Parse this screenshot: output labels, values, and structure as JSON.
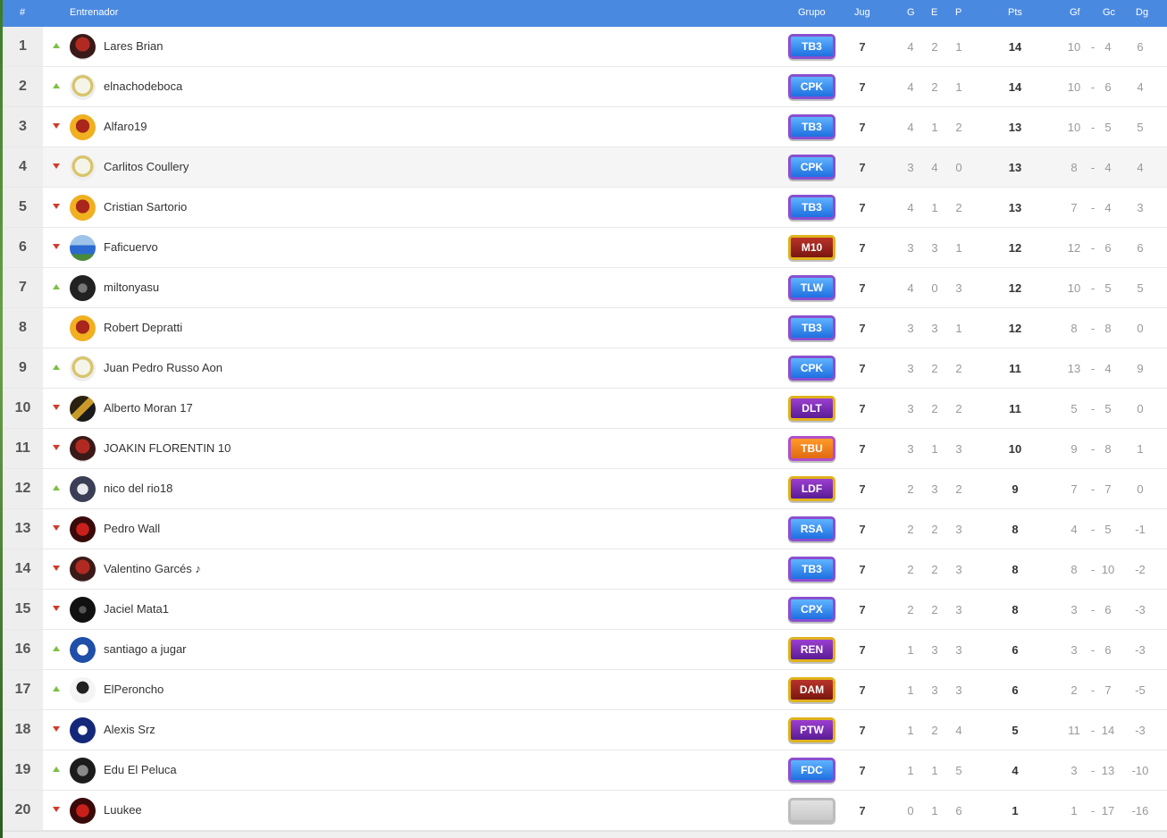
{
  "header": {
    "rank": "#",
    "coach": "Entrenador",
    "group": "Grupo",
    "played": "Jug",
    "won": "G",
    "drawn": "E",
    "lost": "P",
    "points": "Pts",
    "goals_for": "Gf",
    "goals_against": "Gc",
    "goal_diff": "Dg"
  },
  "colors": {
    "header_bg": "#4a89e0",
    "arrow_up": "#7bc043",
    "arrow_down": "#d13b2b"
  },
  "rows": [
    {
      "rank": "1",
      "trend": "up",
      "name": "Lares Brian",
      "group": "TB3",
      "badge": "blue",
      "avatar": "dark-red",
      "jug": "7",
      "g": "4",
      "e": "2",
      "p": "1",
      "pts": "14",
      "gf": "10",
      "gc": "4",
      "dg": "6"
    },
    {
      "rank": "2",
      "trend": "up",
      "name": "elnachodeboca",
      "group": "CPK",
      "badge": "blue",
      "avatar": "white-shirt",
      "jug": "7",
      "g": "4",
      "e": "2",
      "p": "1",
      "pts": "14",
      "gf": "10",
      "gc": "6",
      "dg": "4"
    },
    {
      "rank": "3",
      "trend": "down",
      "name": "Alfaro19",
      "group": "TB3",
      "badge": "blue",
      "avatar": "yellow-red",
      "jug": "7",
      "g": "4",
      "e": "1",
      "p": "2",
      "pts": "13",
      "gf": "10",
      "gc": "5",
      "dg": "5"
    },
    {
      "rank": "4",
      "trend": "down",
      "name": "Carlitos Coullery",
      "group": "CPK",
      "badge": "blue",
      "avatar": "white-shirt",
      "jug": "7",
      "g": "3",
      "e": "4",
      "p": "0",
      "pts": "13",
      "gf": "8",
      "gc": "4",
      "dg": "4"
    },
    {
      "rank": "5",
      "trend": "down",
      "name": "Cristian Sartorio",
      "group": "TB3",
      "badge": "blue",
      "avatar": "yellow-red",
      "jug": "7",
      "g": "4",
      "e": "1",
      "p": "2",
      "pts": "13",
      "gf": "7",
      "gc": "4",
      "dg": "3"
    },
    {
      "rank": "6",
      "trend": "down",
      "name": "Faficuervo",
      "group": "M10",
      "badge": "red",
      "avatar": "field",
      "jug": "7",
      "g": "3",
      "e": "3",
      "p": "1",
      "pts": "12",
      "gf": "12",
      "gc": "6",
      "dg": "6"
    },
    {
      "rank": "7",
      "trend": "up",
      "name": "miltonyasu",
      "group": "TLW",
      "badge": "blue",
      "avatar": "dark",
      "jug": "7",
      "g": "4",
      "e": "0",
      "p": "3",
      "pts": "12",
      "gf": "10",
      "gc": "5",
      "dg": "5"
    },
    {
      "rank": "8",
      "trend": "none",
      "name": "Robert Depratti",
      "group": "TB3",
      "badge": "blue",
      "avatar": "yellow-red",
      "jug": "7",
      "g": "3",
      "e": "3",
      "p": "1",
      "pts": "12",
      "gf": "8",
      "gc": "8",
      "dg": "0"
    },
    {
      "rank": "9",
      "trend": "up",
      "name": "Juan Pedro Russo Aon",
      "group": "CPK",
      "badge": "blue",
      "avatar": "white-shirt",
      "jug": "7",
      "g": "3",
      "e": "2",
      "p": "2",
      "pts": "11",
      "gf": "13",
      "gc": "4",
      "dg": "9"
    },
    {
      "rank": "10",
      "trend": "down",
      "name": "Alberto Moran 17",
      "group": "DLT",
      "badge": "purple",
      "avatar": "car",
      "jug": "7",
      "g": "3",
      "e": "2",
      "p": "2",
      "pts": "11",
      "gf": "5",
      "gc": "5",
      "dg": "0"
    },
    {
      "rank": "11",
      "trend": "down",
      "name": "JOAKIN FLORENTIN 10",
      "group": "TBU",
      "badge": "orange",
      "avatar": "dark-red",
      "jug": "7",
      "g": "3",
      "e": "1",
      "p": "3",
      "pts": "10",
      "gf": "9",
      "gc": "8",
      "dg": "1"
    },
    {
      "rank": "12",
      "trend": "up",
      "name": "nico del rio18",
      "group": "LDF",
      "badge": "purple",
      "avatar": "grey-crest",
      "jug": "7",
      "g": "2",
      "e": "3",
      "p": "2",
      "pts": "9",
      "gf": "7",
      "gc": "7",
      "dg": "0"
    },
    {
      "rank": "13",
      "trend": "down",
      "name": "Pedro Wall",
      "group": "RSA",
      "badge": "blue",
      "avatar": "red-skull",
      "jug": "7",
      "g": "2",
      "e": "2",
      "p": "3",
      "pts": "8",
      "gf": "4",
      "gc": "5",
      "dg": "-1"
    },
    {
      "rank": "14",
      "trend": "down",
      "name": "Valentino Garcés ♪",
      "group": "TB3",
      "badge": "blue",
      "avatar": "dark-red",
      "jug": "7",
      "g": "2",
      "e": "2",
      "p": "3",
      "pts": "8",
      "gf": "8",
      "gc": "10",
      "dg": "-2"
    },
    {
      "rank": "15",
      "trend": "down",
      "name": "Jaciel Mata1",
      "group": "CPX",
      "badge": "blue",
      "avatar": "black-shirt",
      "jug": "7",
      "g": "2",
      "e": "2",
      "p": "3",
      "pts": "8",
      "gf": "3",
      "gc": "6",
      "dg": "-3"
    },
    {
      "rank": "16",
      "trend": "up",
      "name": "santiago a jugar",
      "group": "REN",
      "badge": "purple",
      "avatar": "blue-crest",
      "jug": "7",
      "g": "1",
      "e": "3",
      "p": "3",
      "pts": "6",
      "gf": "3",
      "gc": "6",
      "dg": "-3"
    },
    {
      "rank": "17",
      "trend": "up",
      "name": "ElPeroncho",
      "group": "DAM",
      "badge": "red",
      "avatar": "sketch",
      "jug": "7",
      "g": "1",
      "e": "3",
      "p": "3",
      "pts": "6",
      "gf": "2",
      "gc": "7",
      "dg": "-5"
    },
    {
      "rank": "18",
      "trend": "down",
      "name": "Alexis Srz",
      "group": "PTW",
      "badge": "purple",
      "avatar": "navy-crest",
      "jug": "7",
      "g": "1",
      "e": "2",
      "p": "4",
      "pts": "5",
      "gf": "11",
      "gc": "14",
      "dg": "-3"
    },
    {
      "rank": "19",
      "trend": "up",
      "name": "Edu El Peluca",
      "group": "FDC",
      "badge": "blue",
      "avatar": "wolf",
      "jug": "7",
      "g": "1",
      "e": "1",
      "p": "5",
      "pts": "4",
      "gf": "3",
      "gc": "13",
      "dg": "-10"
    },
    {
      "rank": "20",
      "trend": "down",
      "name": "Luukee",
      "group": "",
      "badge": "grey",
      "avatar": "red-skull",
      "jug": "7",
      "g": "0",
      "e": "1",
      "p": "6",
      "pts": "1",
      "gf": "1",
      "gc": "17",
      "dg": "-16"
    }
  ]
}
